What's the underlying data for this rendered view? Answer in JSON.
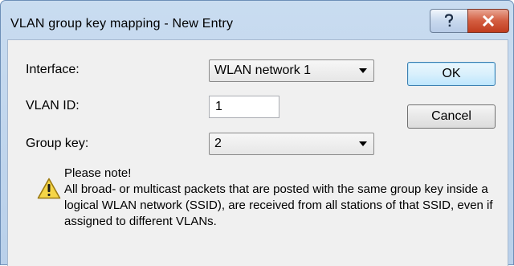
{
  "window": {
    "title": "VLAN group key mapping - New Entry",
    "help_icon": "question-mark-icon",
    "close_icon": "close-x-icon"
  },
  "form": {
    "interface": {
      "label": "Interface:",
      "value": "WLAN network 1"
    },
    "vlan_id": {
      "label": "VLAN ID:",
      "value": "1"
    },
    "group_key": {
      "label": "Group key:",
      "value": "2"
    }
  },
  "buttons": {
    "ok": "OK",
    "cancel": "Cancel"
  },
  "note": {
    "icon": "warning-icon",
    "title": "Please note!",
    "body": "All broad- or multicast packets that are posted with the same group key inside a logical WLAN network (SSID), are received from all stations of that SSID, even if assigned to different VLANs."
  },
  "colors": {
    "title_bar": "#c9dcf0",
    "client_bg": "#f0f0f0",
    "close_button": "#d35d40",
    "default_button": "#bee6fd",
    "warning": "#f5d547"
  }
}
